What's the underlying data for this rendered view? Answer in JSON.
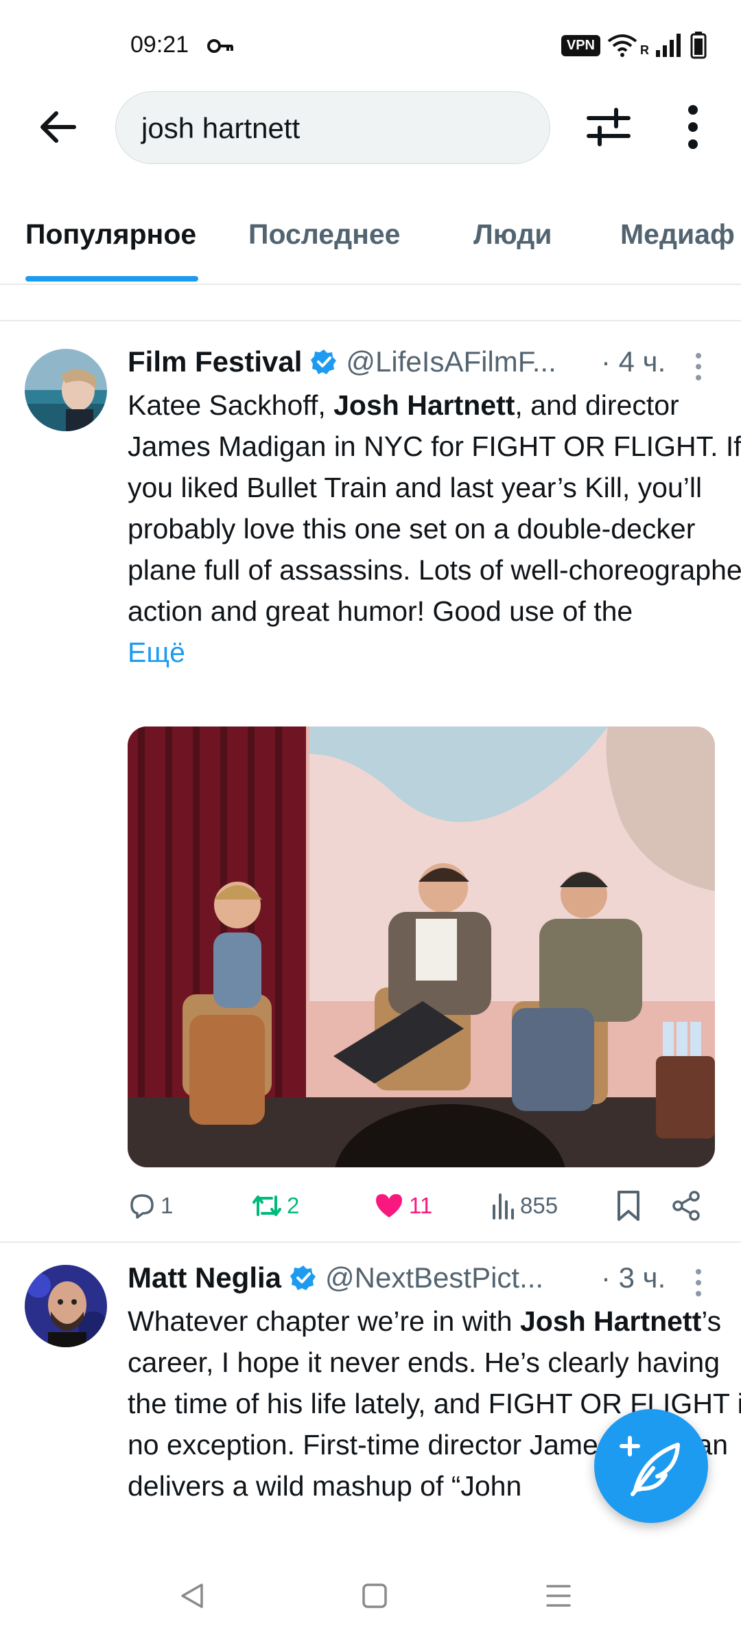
{
  "status_bar": {
    "time": "09:21",
    "vpn_label": "VPN",
    "roaming_label": "R",
    "icons": [
      "key-icon",
      "vpn-icon",
      "wifi-icon",
      "signal-icon",
      "battery-icon"
    ]
  },
  "search": {
    "query": "josh hartnett"
  },
  "tabs": [
    {
      "label": "Популярное",
      "active": true
    },
    {
      "label": "Последнее",
      "active": false
    },
    {
      "label": "Люди",
      "active": false
    },
    {
      "label": "Медиаф",
      "active": false
    }
  ],
  "tweets": [
    {
      "name": "Film Festival",
      "handle": "@LifeIsAFilmF...",
      "time": "· 4 ч.",
      "verified": true,
      "text_segments": [
        {
          "text": "Katee Sackhoff, ",
          "bold": false
        },
        {
          "text": "Josh Hartnett",
          "bold": true
        },
        {
          "text": ", and director James Madigan in NYC for FIGHT OR FLIGHT. If you liked Bullet Train and last year’s Kill, you’ll probably love this one set on a double-decker plane full of assassins. Lots of well-choreographed action and great humor! Good use of the",
          "bold": false
        }
      ],
      "more_label": "Ещё",
      "stats": {
        "replies": "1",
        "retweets": "2",
        "likes": "11",
        "views": "855"
      },
      "liked": true
    },
    {
      "name": "Matt Neglia",
      "handle": "@NextBestPict...",
      "time": "· 3 ч.",
      "verified": true,
      "text_segments": [
        {
          "text": "Whatever chapter we’re in with ",
          "bold": false
        },
        {
          "text": "Josh Hartnett",
          "bold": true
        },
        {
          "text": "’s career, I hope it never ends. He’s clearly having the time of his life lately, and FIGHT OR FLIGHT is no exception. First-time director James Madigan delivers a wild mashup of “John",
          "bold": false
        }
      ]
    }
  ],
  "colors": {
    "accent": "#1d9bf0",
    "like": "#f91880",
    "retweet": "#00ba7c",
    "secondary_text": "#536471"
  }
}
